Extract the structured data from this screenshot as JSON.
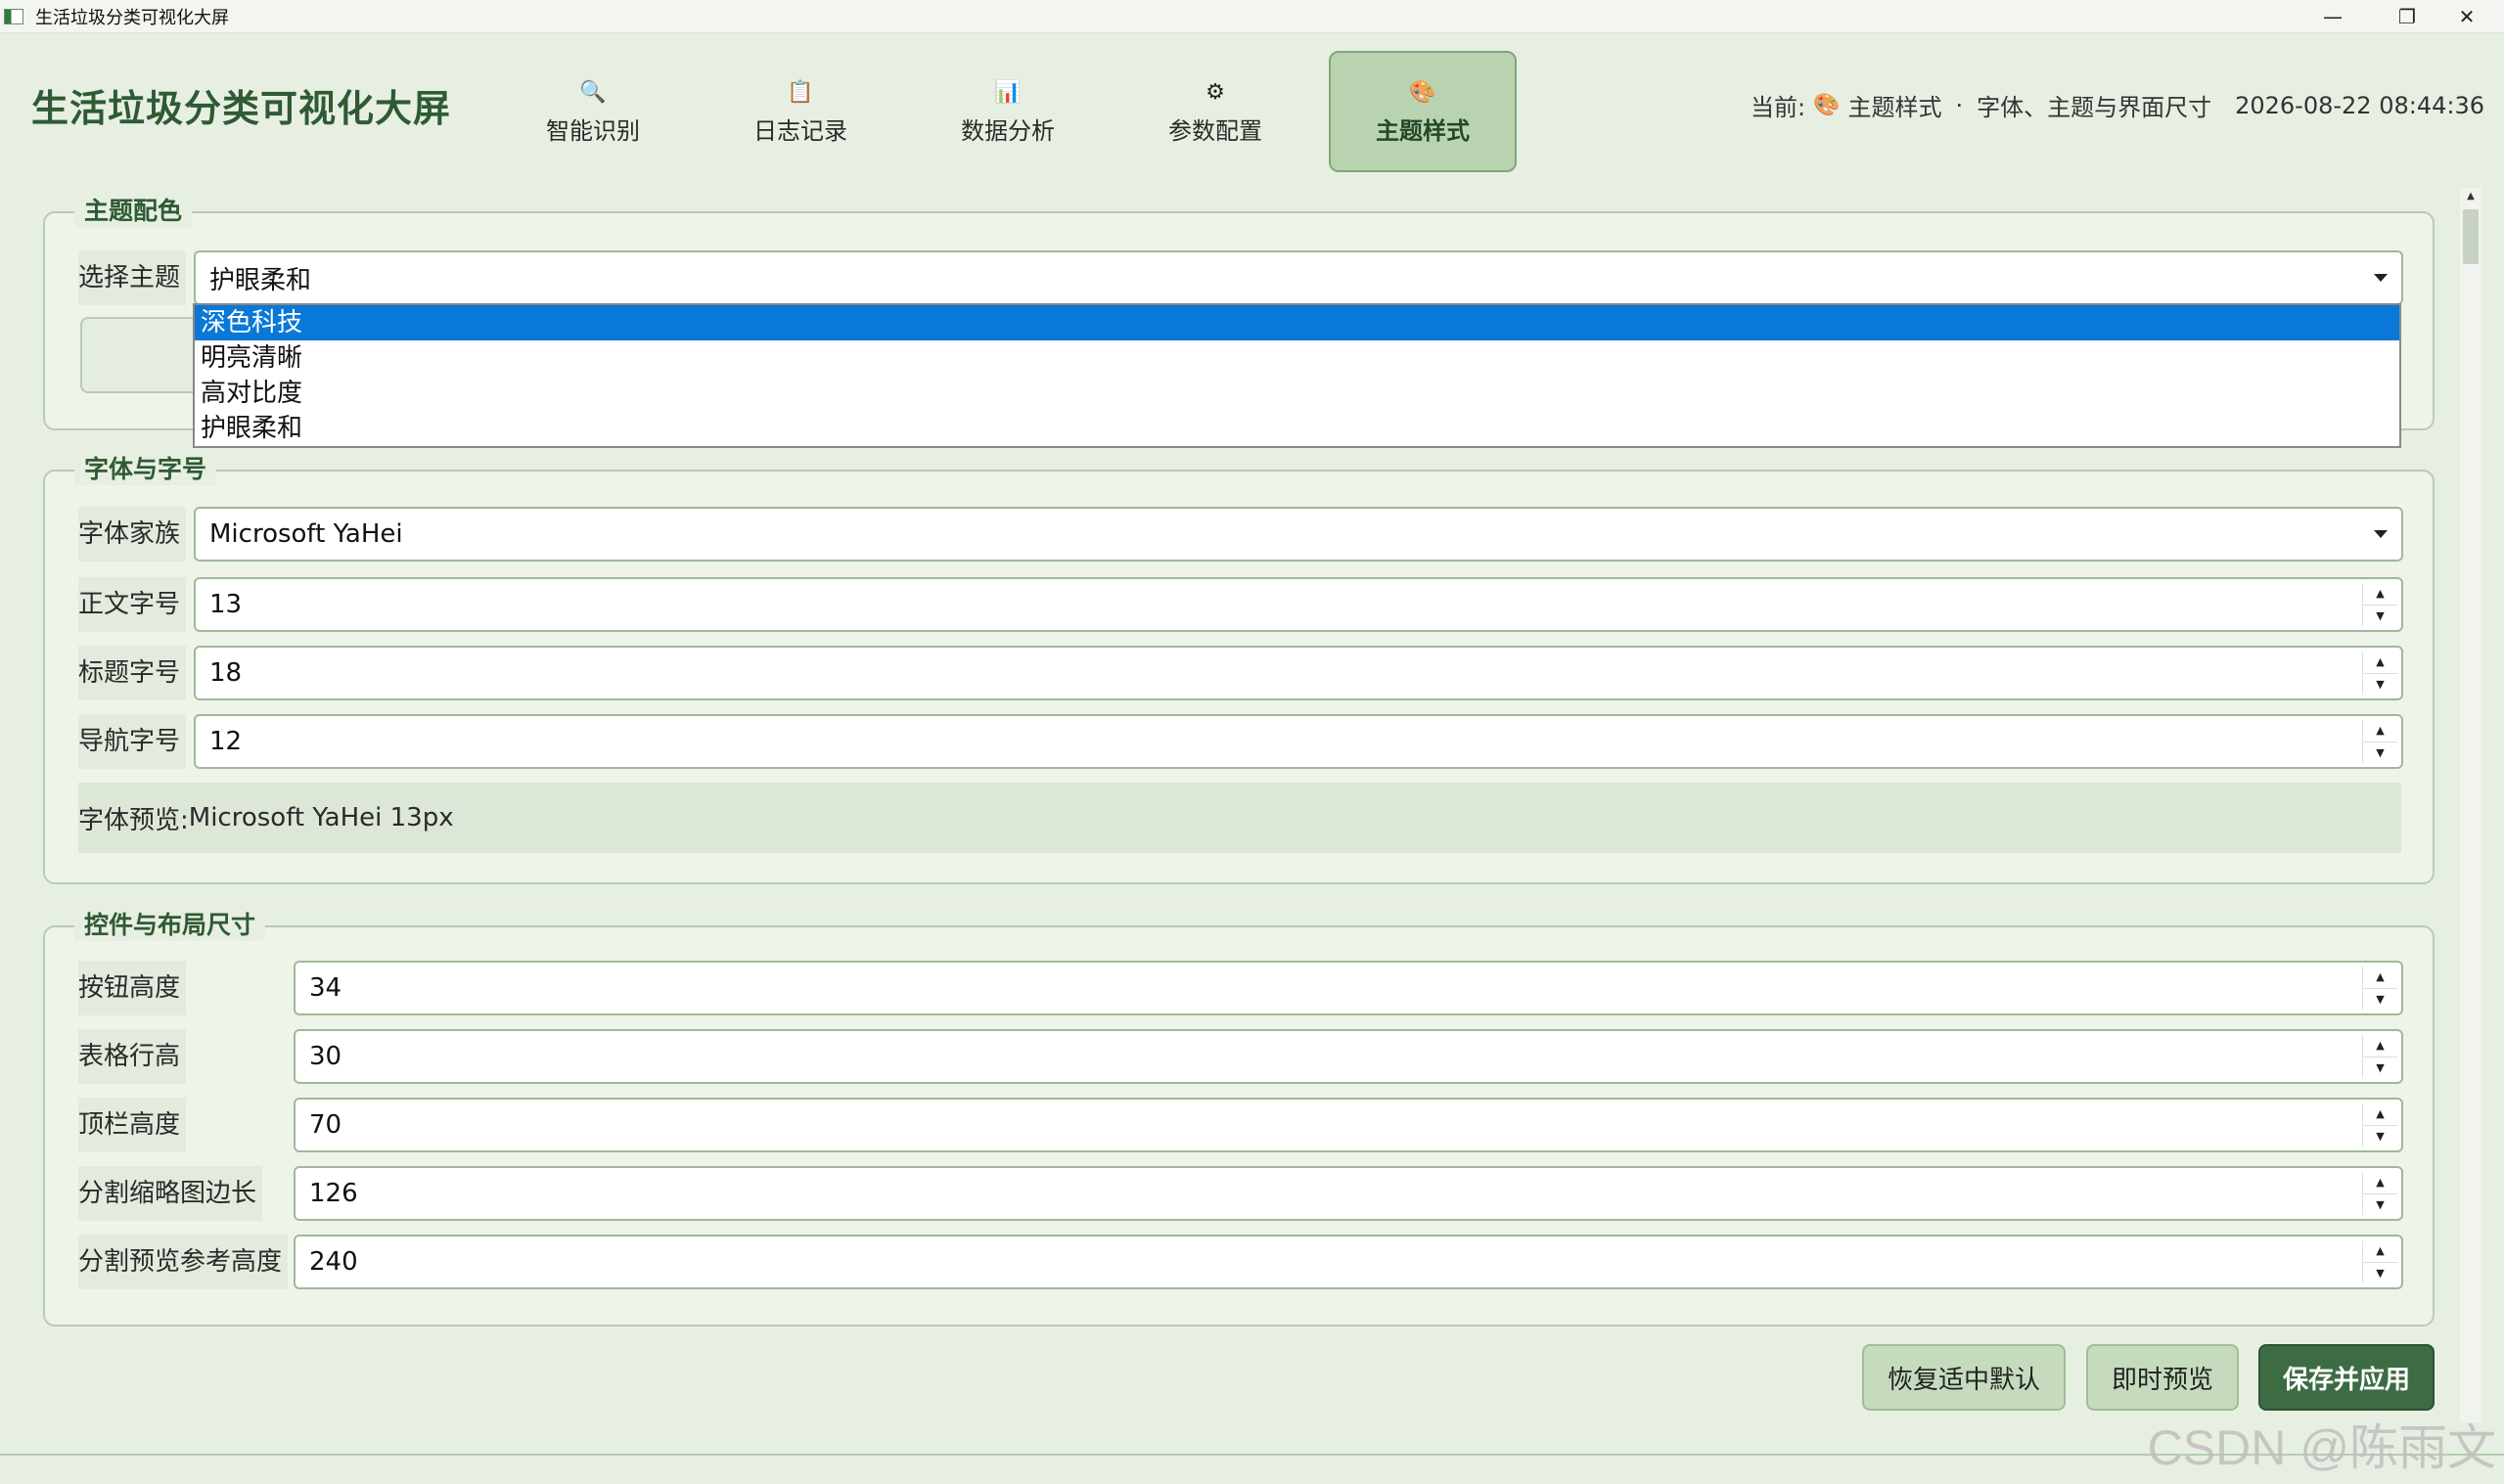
{
  "window": {
    "title": "生活垃圾分类可视化大屏",
    "controls": {
      "minimize": "—",
      "maximize": "❐",
      "close": "✕"
    }
  },
  "header": {
    "app_title": "生活垃圾分类可视化大屏",
    "tabs": [
      {
        "label": "智能识别",
        "icon": "search-icon",
        "glyph": "🔍"
      },
      {
        "label": "日志记录",
        "icon": "clipboard-icon",
        "glyph": "📋"
      },
      {
        "label": "数据分析",
        "icon": "bar-chart-icon",
        "glyph": "📊"
      },
      {
        "label": "参数配置",
        "icon": "gear-icon",
        "glyph": "⚙"
      },
      {
        "label": "主题样式",
        "icon": "palette-icon",
        "glyph": "🎨",
        "active": true
      }
    ],
    "status": {
      "prefix": "当前:",
      "icon": "palette-icon",
      "glyph": "🎨",
      "page": "主题样式",
      "separator": "·",
      "desc": "字体、主题与界面尺寸",
      "datetime": "2026-08-22 08:44:36"
    }
  },
  "theme_group": {
    "title": "主题配色",
    "select_label": "选择主题",
    "selected": "护眼柔和",
    "options": [
      "深色科技",
      "明亮清晰",
      "高对比度",
      "护眼柔和"
    ],
    "highlighted_option": "深色科技"
  },
  "font_group": {
    "title": "字体与字号",
    "family_label": "字体家族",
    "family_value": "Microsoft YaHei",
    "body_size_label": "正文字号",
    "body_size_value": "13",
    "title_size_label": "标题字号",
    "title_size_value": "18",
    "nav_size_label": "导航字号",
    "nav_size_value": "12",
    "preview_label": "字体预览:",
    "preview_text": "Microsoft YaHei 13px"
  },
  "layout_group": {
    "title": "控件与布局尺寸",
    "fields": [
      {
        "label": "按钮高度",
        "value": "34"
      },
      {
        "label": "表格行高",
        "value": "30"
      },
      {
        "label": "顶栏高度",
        "value": "70"
      },
      {
        "label": "分割缩略图边长",
        "value": "126"
      },
      {
        "label": "分割预览参考高度",
        "value": "240"
      }
    ]
  },
  "actions": {
    "reset": "恢复适中默认",
    "preview": "即时预览",
    "save": "保存并应用"
  },
  "watermark": "CSDN @陈雨文",
  "colors": {
    "accent": "#2f5a34",
    "active_tab": "#b9d3b0",
    "primary_button": "#3c6b44",
    "selection": "#0a78d7"
  }
}
